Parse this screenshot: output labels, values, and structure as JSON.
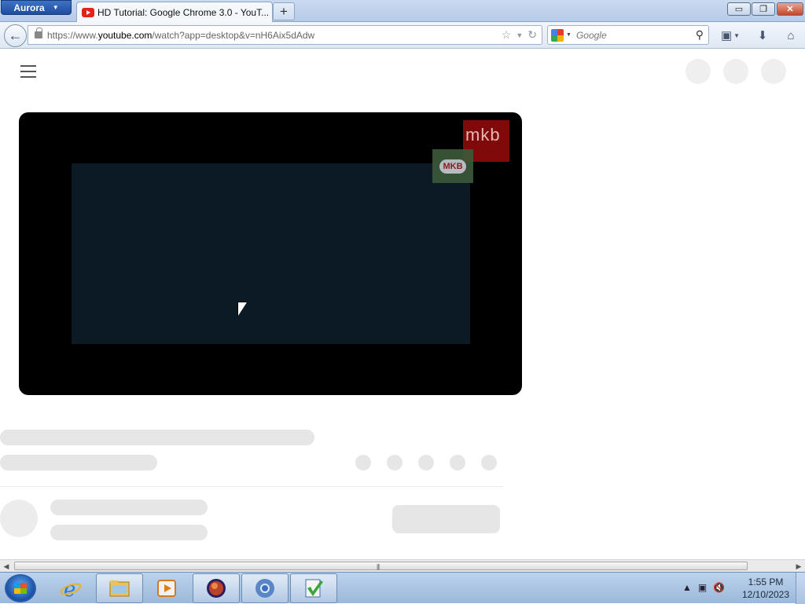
{
  "browser": {
    "menu_button": "Aurora",
    "tab_title": "HD Tutorial: Google Chrome 3.0 - YouT...",
    "new_tab": "+",
    "url_prefix": "https://www.",
    "url_domain": "youtube.com",
    "url_suffix": "/watch?app=desktop&v=nH6Aix5dAdw",
    "search_placeholder": "Google"
  },
  "window_controls": {
    "minimize": "▭",
    "maximize": "❐",
    "close": "✕"
  },
  "video": {
    "watermark_text": "mkb",
    "badge_text": "MKB"
  },
  "taskbar": {
    "items": [
      {
        "icon": "internet-explorer-icon"
      },
      {
        "icon": "windows-explorer-icon"
      },
      {
        "icon": "media-player-icon"
      },
      {
        "icon": "firefox-aurora-icon"
      },
      {
        "icon": "chrome-icon"
      },
      {
        "icon": "app-checkmark-icon"
      }
    ],
    "clock_time": "1:55 PM",
    "clock_date": "12/10/2023"
  },
  "colors": {
    "title_bar": "#c9daf0",
    "video_frame": "#0c1a25",
    "watermark_red": "#8e0b0b",
    "skeleton": "#e6e6e6"
  }
}
